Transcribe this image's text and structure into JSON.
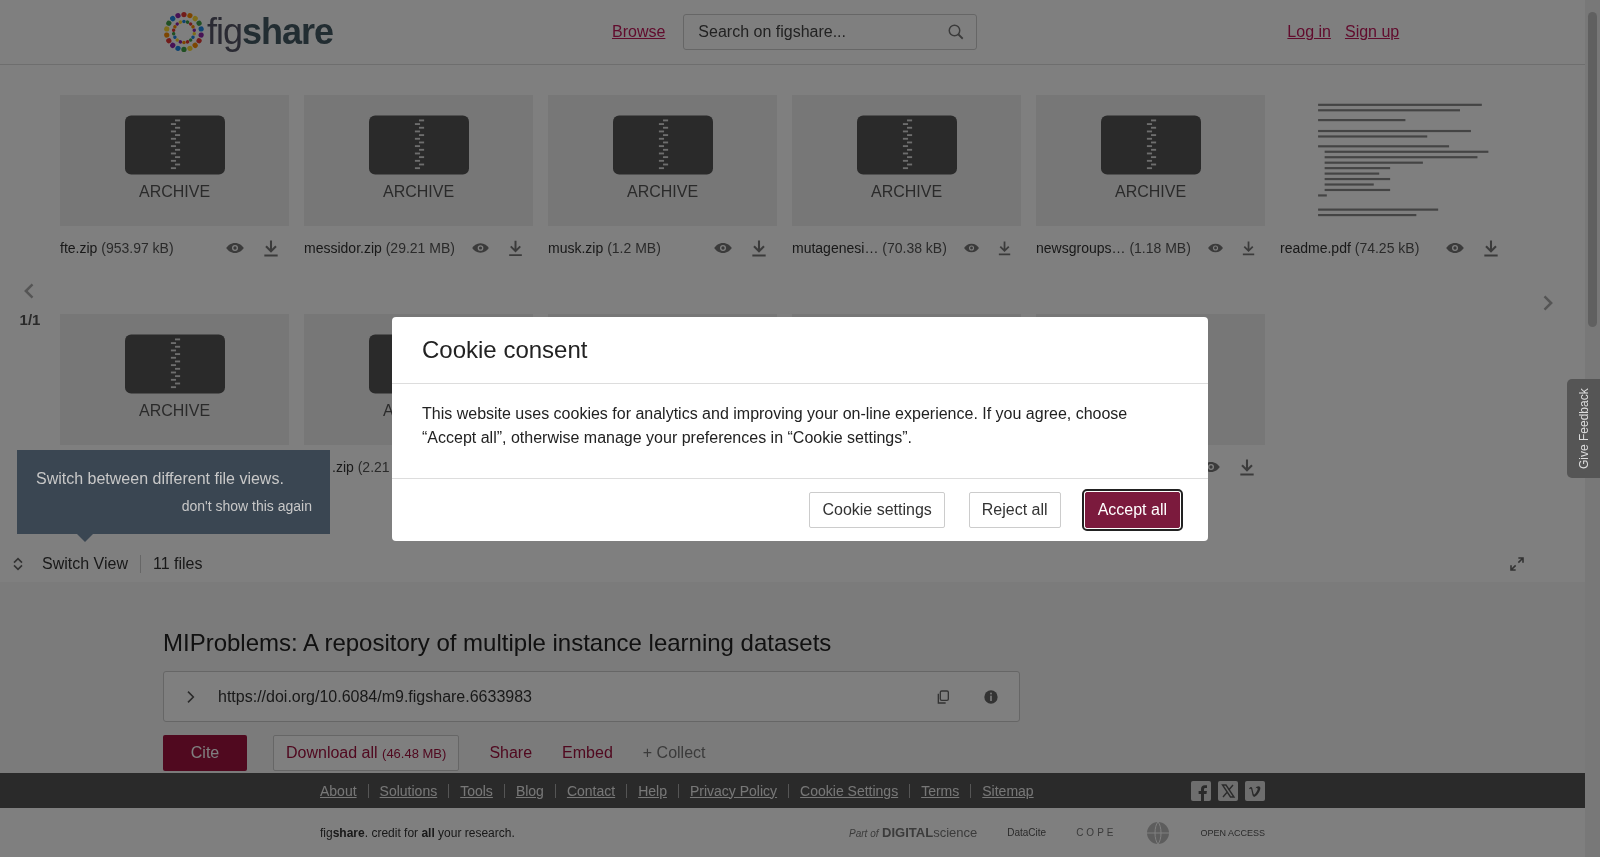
{
  "header": {
    "logo": "fig**share**",
    "browse": "Browse",
    "search": {
      "placeholder": "Search on figshare..."
    },
    "auth": [
      "Log in",
      "Sign up"
    ]
  },
  "files": {
    "rows": [
      [
        {
          "kind": "archive",
          "label": "ARCHIVE",
          "name": "fte.zip",
          "size": "(953.97 kB)",
          "actions": true
        },
        {
          "kind": "archive",
          "label": "ARCHIVE",
          "name": "messidor.zip",
          "size": "(29.21 MB)",
          "actions": true
        },
        {
          "kind": "archive",
          "label": "ARCHIVE",
          "name": "musk.zip",
          "size": "(1.2 MB)",
          "actions": true
        },
        {
          "kind": "archive",
          "label": "ARCHIVE",
          "name": "mutagenesi…",
          "size": "(70.38 kB)",
          "actions": true
        },
        {
          "kind": "archive",
          "label": "ARCHIVE",
          "name": "newsgroups…",
          "size": "(1.18 MB)",
          "actions": true
        },
        {
          "kind": "document",
          "name": "readme.pdf",
          "size": "(74.25 kB)",
          "actions": true
        }
      ],
      [
        {
          "kind": "archive",
          "label": "ARCHIVE"
        },
        {
          "kind": "partial",
          "label": "A",
          "name": ".zip",
          "size": "(2.21"
        },
        {
          "kind": "blank"
        },
        {
          "kind": "blank"
        },
        {
          "kind": "blank",
          "actions": true
        }
      ]
    ],
    "pager": "1/1",
    "tooltip": {
      "text": "Switch between different file views.",
      "dismiss": "don't show this again"
    },
    "switch_view": "Switch View",
    "count": "11 files"
  },
  "item": {
    "title": "MIProblems: A repository of multiple instance learning datasets",
    "doi": "https://doi.org/10.6084/m9.figshare.6633983",
    "actions": [
      {
        "kind": "primary",
        "label": "Cite"
      },
      {
        "kind": "outline",
        "label": "Download all",
        "size": "(46.48 MB)"
      },
      {
        "kind": "link",
        "label": "Share"
      },
      {
        "kind": "link",
        "label": "Embed"
      },
      {
        "kind": "muted",
        "label": "+ Collect"
      }
    ]
  },
  "footer": {
    "links": [
      "About",
      "Solutions",
      "Tools",
      "Blog",
      "Contact",
      "Help",
      "Privacy Policy",
      "Cookie Settings",
      "Terms",
      "Sitemap"
    ],
    "social": [
      {
        "kind": "facebook"
      },
      {
        "kind": "x"
      },
      {
        "kind": "vimeo"
      }
    ],
    "tagline": "fig**share**. credit for **all** your research.",
    "partners": [
      {
        "kind": "digital-science",
        "prefix": "Part of",
        "name": "DIGITAL",
        "suffix": "science"
      },
      {
        "kind": "datacite",
        "name": "DataCite"
      },
      {
        "kind": "cope",
        "name": "COPE"
      },
      {
        "kind": "globe"
      },
      {
        "kind": "open-access",
        "name": "OPEN ACCESS"
      }
    ]
  },
  "feedback": "Give Feedback",
  "modal": {
    "title": "Cookie consent",
    "body": "This website uses cookies for analytics and improving your on-line experience. If you agree, choose “Accept all”, otherwise manage your preferences in “Cookie settings”.",
    "buttons": [
      {
        "kind": "secondary",
        "label": "Cookie settings"
      },
      {
        "kind": "secondary",
        "label": "Reject all"
      },
      {
        "kind": "primary",
        "label": "Accept all"
      }
    ]
  }
}
